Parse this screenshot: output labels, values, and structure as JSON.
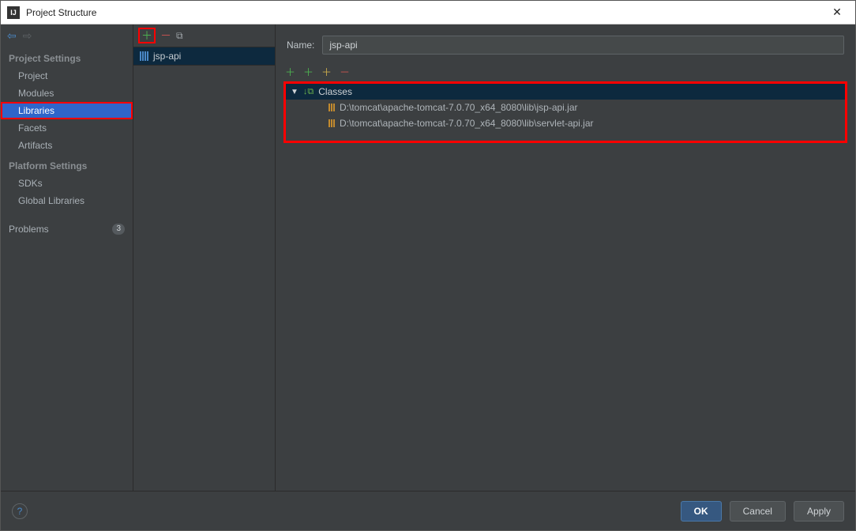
{
  "window": {
    "title": "Project Structure"
  },
  "sidebar": {
    "sections": {
      "project": {
        "header": "Project Settings",
        "items": [
          "Project",
          "Modules",
          "Libraries",
          "Facets",
          "Artifacts"
        ]
      },
      "platform": {
        "header": "Platform Settings",
        "items": [
          "SDKs",
          "Global Libraries"
        ]
      }
    },
    "problems": {
      "label": "Problems",
      "badge": "3"
    }
  },
  "libraries_list": {
    "items": [
      "jsp-api"
    ]
  },
  "detail": {
    "name_label": "Name:",
    "name_value": "jsp-api",
    "tree": {
      "group_label": "Classes",
      "items": [
        "D:\\tomcat\\apache-tomcat-7.0.70_x64_8080\\lib\\jsp-api.jar",
        "D:\\tomcat\\apache-tomcat-7.0.70_x64_8080\\lib\\servlet-api.jar"
      ]
    }
  },
  "footer": {
    "ok": "OK",
    "cancel": "Cancel",
    "apply": "Apply"
  }
}
